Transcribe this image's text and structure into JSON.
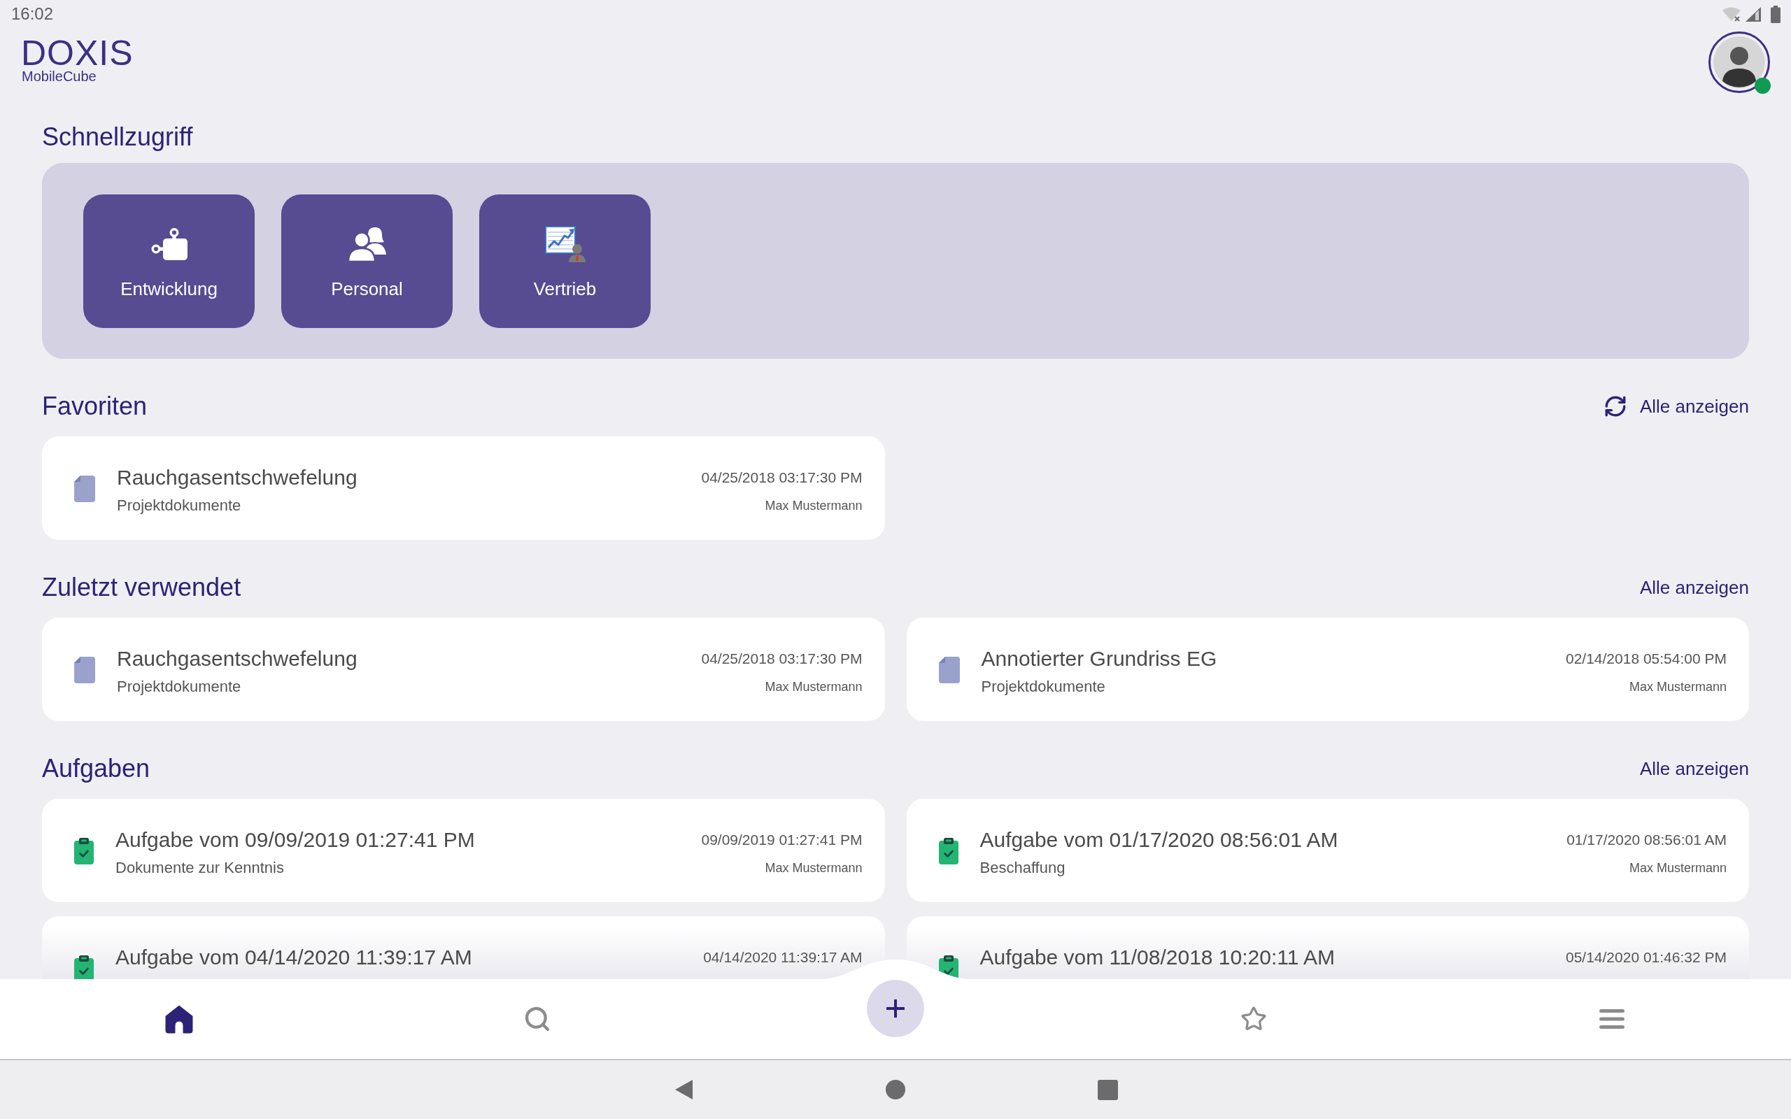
{
  "status_bar": {
    "time": "16:02"
  },
  "header": {
    "logo": {
      "wordmark": "DOXIS",
      "product": "MobileCube"
    },
    "user": {
      "online": true
    }
  },
  "quick_access": {
    "title": "Schnellzugriff",
    "tiles": [
      {
        "label": "Entwicklung"
      },
      {
        "label": "Personal"
      },
      {
        "label": "Vertrieb"
      }
    ]
  },
  "sections": [
    {
      "title": "Favoriten",
      "link": "Alle anzeigen",
      "refreshable": true,
      "items": [
        {
          "kind": "document",
          "title": "Rauchgasentschwefelung",
          "subtitle": "Projektdokumente",
          "date": "04/25/2018 03:17:30 PM",
          "author": "Max Mustermann"
        }
      ]
    },
    {
      "title": "Zuletzt verwendet",
      "link": "Alle anzeigen",
      "items": [
        {
          "kind": "document",
          "title": "Rauchgasentschwefelung",
          "subtitle": "Projektdokumente",
          "date": "04/25/2018 03:17:30 PM",
          "author": "Max Mustermann"
        },
        {
          "kind": "document",
          "title": "Annotierter Grundriss EG",
          "subtitle": "Projektdokumente",
          "date": "02/14/2018 05:54:00 PM",
          "author": "Max Mustermann"
        }
      ]
    },
    {
      "title": "Aufgaben",
      "link": "Alle anzeigen",
      "items": [
        {
          "kind": "task",
          "title": "Aufgabe vom 09/09/2019 01:27:41 PM",
          "subtitle": "Dokumente zur Kenntnis",
          "date": "09/09/2019 01:27:41 PM",
          "author": "Max Mustermann"
        },
        {
          "kind": "task",
          "title": "Aufgabe vom 01/17/2020 08:56:01 AM",
          "subtitle": "Beschaffung",
          "date": "01/17/2020 08:56:01 AM",
          "author": "Max Mustermann"
        },
        {
          "kind": "task",
          "title": "Aufgabe vom 04/14/2020 11:39:17 AM",
          "date": "04/14/2020 11:39:17 AM"
        },
        {
          "kind": "task",
          "title": "Aufgabe vom 11/08/2018 10:20:11 AM",
          "date": "05/14/2020 01:46:32 PM"
        }
      ]
    }
  ],
  "bottom_nav": {
    "tabs": [
      {
        "selected": true
      },
      {
        "selected": false
      },
      {
        "selected": false
      },
      {
        "selected": false
      }
    ]
  }
}
